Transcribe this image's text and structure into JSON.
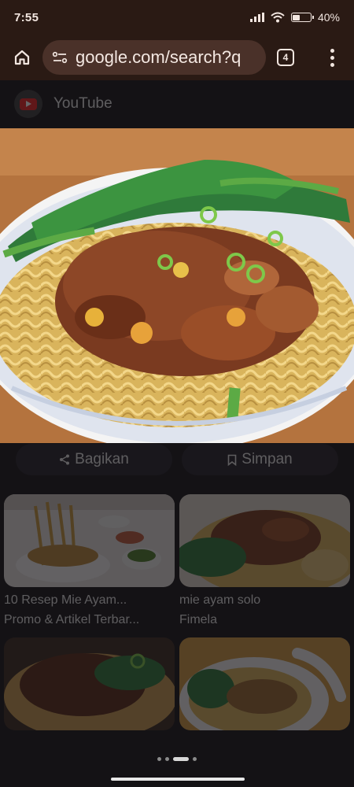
{
  "status": {
    "time": "7:55",
    "battery": "40%"
  },
  "toolbar": {
    "url": "google.com/search?q",
    "tab_count": "4"
  },
  "source": {
    "name": "YouTube"
  },
  "actions": {
    "share_label": "Bagikan",
    "save_label": "Simpan"
  },
  "results": [
    {
      "title": "10 Resep Mie Ayam...",
      "source": "Promo & Artikel Terbar..."
    },
    {
      "title": "mie ayam solo",
      "source": "Fimela"
    }
  ],
  "pager": {
    "count": 4,
    "active": 2
  }
}
